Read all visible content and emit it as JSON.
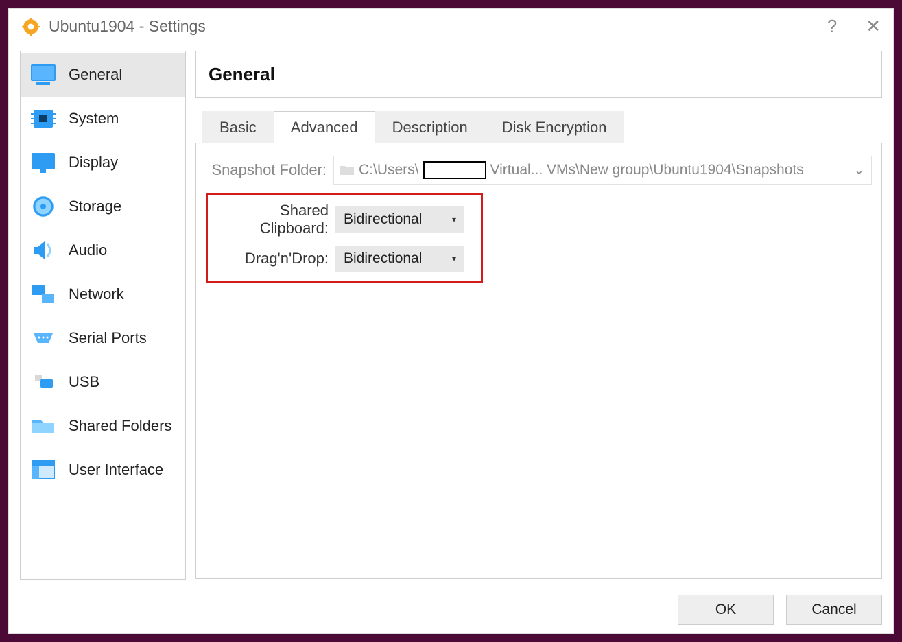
{
  "titlebar": {
    "title": "Ubuntu1904 - Settings",
    "help_glyph": "?",
    "close_glyph": "✕"
  },
  "sidebar": {
    "items": [
      {
        "label": "General"
      },
      {
        "label": "System"
      },
      {
        "label": "Display"
      },
      {
        "label": "Storage"
      },
      {
        "label": "Audio"
      },
      {
        "label": "Network"
      },
      {
        "label": "Serial Ports"
      },
      {
        "label": "USB"
      },
      {
        "label": "Shared Folders"
      },
      {
        "label": "User Interface"
      }
    ]
  },
  "main": {
    "header": "General",
    "tabs": [
      {
        "label": "Basic"
      },
      {
        "label": "Advanced"
      },
      {
        "label": "Description"
      },
      {
        "label": "Disk Encryption"
      }
    ],
    "advanced": {
      "snapshot_label": "Snapshot Folder:",
      "snapshot_prefix": "C:\\Users\\",
      "snapshot_suffix": "Virtual... VMs\\New group\\Ubuntu1904\\Snapshots",
      "clipboard_label": "Shared Clipboard:",
      "clipboard_value": "Bidirectional",
      "dnd_label": "Drag'n'Drop:",
      "dnd_value": "Bidirectional"
    }
  },
  "footer": {
    "ok": "OK",
    "cancel": "Cancel"
  },
  "colors": {
    "accent_blue": "#2f9cf4",
    "highlight_red": "#d21c1c"
  }
}
